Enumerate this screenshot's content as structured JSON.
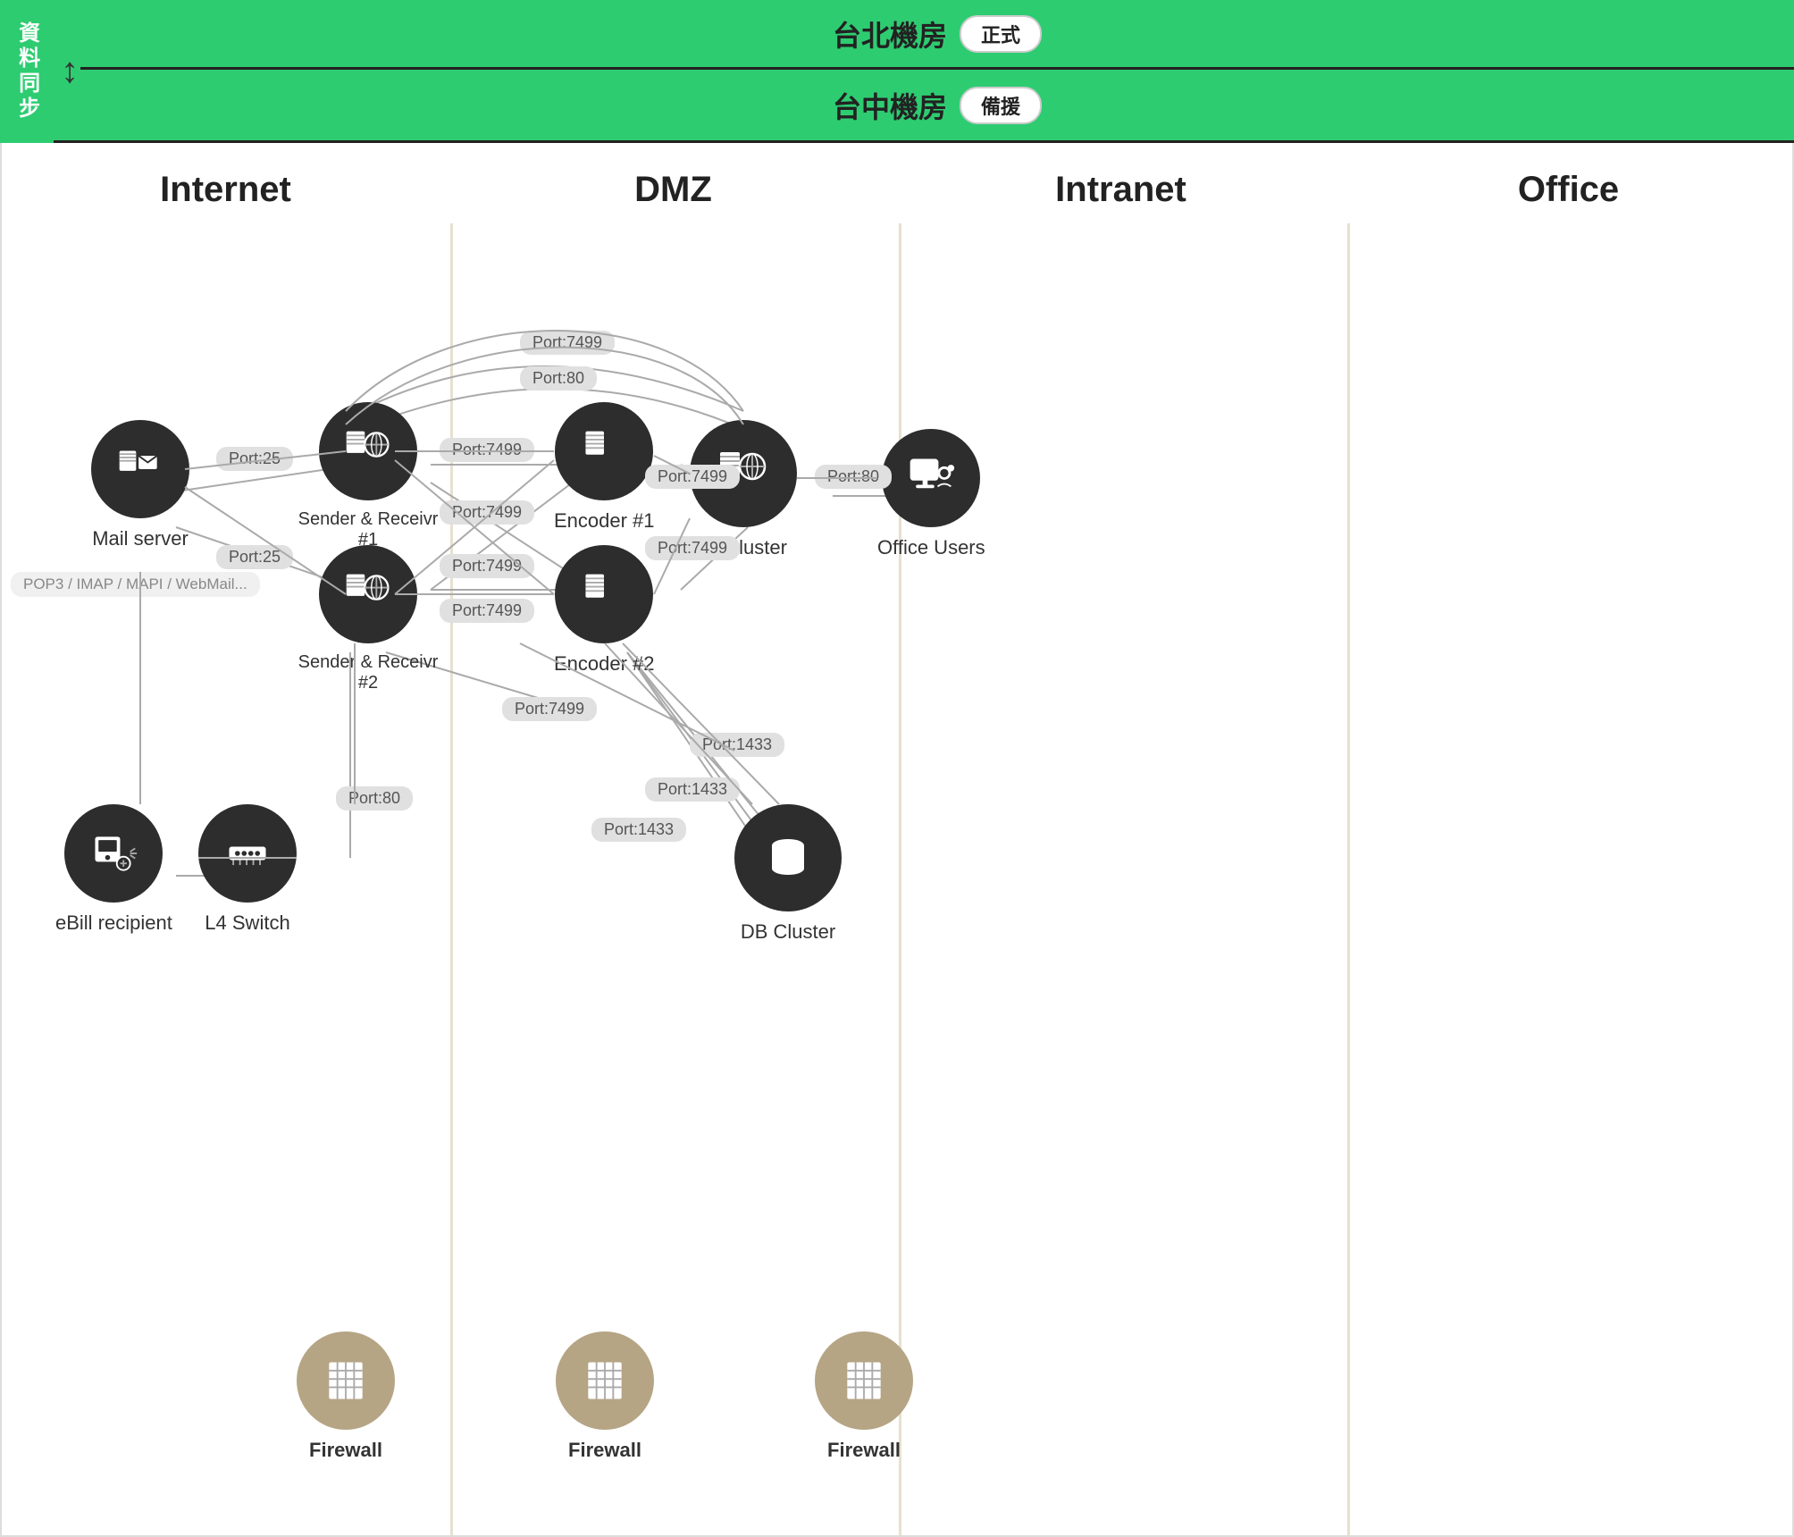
{
  "header": {
    "sync_label": "資料同步",
    "dc1_name": "台北機房",
    "dc1_badge": "正式",
    "dc2_name": "台中機房",
    "dc2_badge": "備援"
  },
  "zones": {
    "internet": "Internet",
    "dmz": "DMZ",
    "intranet": "Intranet",
    "office": "Office"
  },
  "nodes": {
    "mail_server": "Mail server",
    "ebill": "eBill recipient",
    "l4switch": "L4 Switch",
    "sender1": "Sender & Receivr #1",
    "sender2": "Sender & Receivr #2",
    "encoder1": "Encoder #1",
    "encoder2": "Encoder #2",
    "ui_cluster": "UI Cluster",
    "db_cluster": "DB Cluster",
    "office_users": "Office Users",
    "firewall1": "Firewall",
    "firewall2": "Firewall",
    "firewall3": "Firewall"
  },
  "ports": {
    "p25_1": "Port:25",
    "p25_2": "Port:25",
    "p80_1": "Port:80",
    "p80_2": "Port:80",
    "p7499_1": "Port:7499",
    "p7499_2": "Port:7499",
    "p7499_3": "Port:7499",
    "p7499_4": "Port:7499",
    "p7499_5": "Port:7499",
    "p7499_6": "Port:7499",
    "p7499_7": "Port:7499",
    "p1433_1": "Port:1433",
    "p1433_2": "Port:1433",
    "p1433_3": "Port:1433",
    "sublabel": "POP3 / IMAP / MAPI / WebMail..."
  },
  "colors": {
    "green": "#2ecc71",
    "dark_node": "#2d2d2d",
    "firewall_node": "#b5a585",
    "divider": "#e8e0d0",
    "port_bg": "#e0e0e0"
  }
}
